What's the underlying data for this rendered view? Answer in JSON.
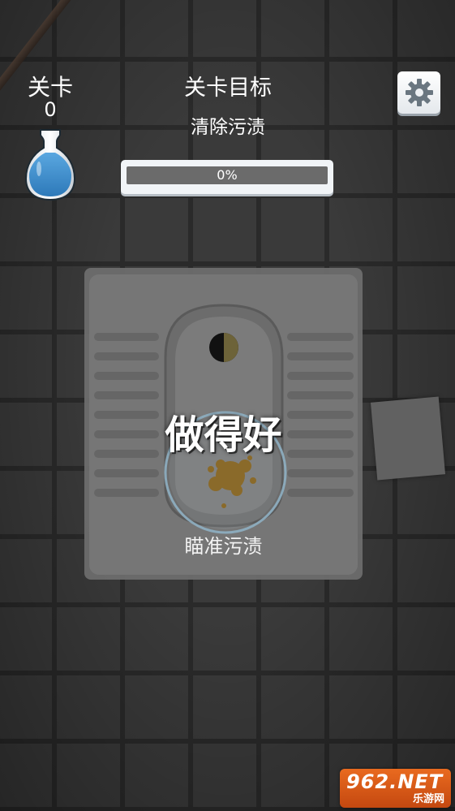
{
  "hud": {
    "level_label": "关卡",
    "level_value": "0",
    "goal_title": "关卡目标",
    "goal_subtitle": "清除污渍",
    "progress_text": "0%",
    "progress_value": 0,
    "progress_fill_color": "#5fb7ff",
    "settings_icon": "gear-icon",
    "vase_icon": "vase-icon"
  },
  "stage": {
    "result_text": "做得好",
    "hint_text": "瞄准污渍",
    "stain_color": "#8a6a2a"
  },
  "watermark": {
    "brand": "962.NET",
    "sub": "乐游网"
  }
}
